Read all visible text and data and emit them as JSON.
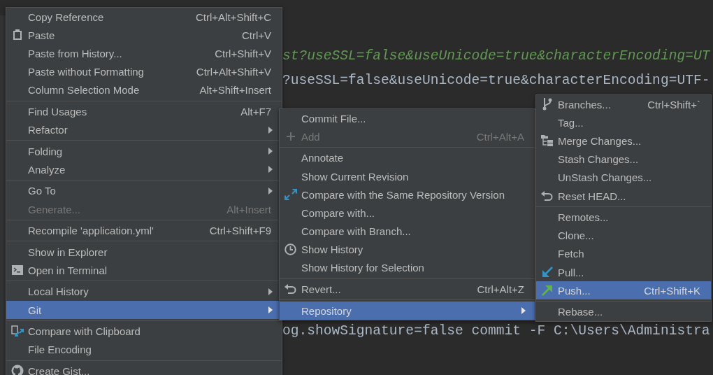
{
  "editor": {
    "lines": [
      {
        "kind": "string",
        "text": "st?useSSL=false&useUnicode=true&characterEncoding=UT"
      },
      {
        "kind": "plain",
        "text": "?useSSL=false&useUnicode=true&characterEncoding=UTF-"
      },
      {
        "kind": "plain",
        "text": "og.showSignature=false commit -F C:\\Users\\Administra"
      }
    ]
  },
  "menus": [
    {
      "items": [
        {
          "kind": "item",
          "label": "Copy Reference",
          "shortcut": "Ctrl+Alt+Shift+C",
          "submenu": false,
          "disabled": false,
          "selected": false
        },
        {
          "kind": "item",
          "label": "Paste",
          "shortcut": "Ctrl+V",
          "submenu": false,
          "disabled": false,
          "selected": false
        },
        {
          "kind": "item",
          "label": "Paste from History...",
          "shortcut": "Ctrl+Shift+V",
          "submenu": false,
          "disabled": false,
          "selected": false
        },
        {
          "kind": "item",
          "label": "Paste without Formatting",
          "shortcut": "Ctrl+Alt+Shift+V",
          "submenu": false,
          "disabled": false,
          "selected": false
        },
        {
          "kind": "item",
          "label": "Column Selection Mode",
          "shortcut": "Alt+Shift+Insert",
          "submenu": false,
          "disabled": false,
          "selected": false
        },
        {
          "kind": "separator"
        },
        {
          "kind": "item",
          "label": "Find Usages",
          "shortcut": "Alt+F7",
          "submenu": false,
          "disabled": false,
          "selected": false
        },
        {
          "kind": "item",
          "label": "Refactor",
          "submenu": true,
          "disabled": false,
          "selected": false
        },
        {
          "kind": "separator"
        },
        {
          "kind": "item",
          "label": "Folding",
          "submenu": true,
          "disabled": false,
          "selected": false
        },
        {
          "kind": "item",
          "label": "Analyze",
          "submenu": true,
          "disabled": false,
          "selected": false
        },
        {
          "kind": "separator"
        },
        {
          "kind": "item",
          "label": "Go To",
          "submenu": true,
          "disabled": false,
          "selected": false
        },
        {
          "kind": "item",
          "label": "Generate...",
          "shortcut": "Alt+Insert",
          "submenu": false,
          "disabled": true,
          "selected": false
        },
        {
          "kind": "separator"
        },
        {
          "kind": "item",
          "label": "Recompile 'application.yml'",
          "shortcut": "Ctrl+Shift+F9",
          "submenu": false,
          "disabled": false,
          "selected": false
        },
        {
          "kind": "separator"
        },
        {
          "kind": "item",
          "label": "Show in Explorer",
          "submenu": false,
          "disabled": false,
          "selected": false
        },
        {
          "kind": "item",
          "label": "Open in Terminal",
          "submenu": false,
          "disabled": false,
          "selected": false
        },
        {
          "kind": "separator"
        },
        {
          "kind": "item",
          "label": "Local History",
          "submenu": true,
          "disabled": false,
          "selected": false
        },
        {
          "kind": "item",
          "label": "Git",
          "submenu": true,
          "disabled": false,
          "selected": true
        },
        {
          "kind": "separator"
        },
        {
          "kind": "item",
          "label": "Compare with Clipboard",
          "submenu": false,
          "disabled": false,
          "selected": false
        },
        {
          "kind": "item",
          "label": "File Encoding",
          "submenu": false,
          "disabled": false,
          "selected": false
        },
        {
          "kind": "separator"
        },
        {
          "kind": "item",
          "label": "Create Gist...",
          "submenu": false,
          "disabled": false,
          "selected": false
        }
      ]
    },
    {
      "items": [
        {
          "kind": "item",
          "label": "Commit File...",
          "submenu": false,
          "disabled": false,
          "selected": false
        },
        {
          "kind": "item",
          "label": "Add",
          "shortcut": "Ctrl+Alt+A",
          "submenu": false,
          "disabled": true,
          "selected": false
        },
        {
          "kind": "separator"
        },
        {
          "kind": "item",
          "label": "Annotate",
          "submenu": false,
          "disabled": false,
          "selected": false
        },
        {
          "kind": "item",
          "label": "Show Current Revision",
          "submenu": false,
          "disabled": false,
          "selected": false
        },
        {
          "kind": "item",
          "label": "Compare with the Same Repository Version",
          "submenu": false,
          "disabled": false,
          "selected": false
        },
        {
          "kind": "item",
          "label": "Compare with...",
          "submenu": false,
          "disabled": false,
          "selected": false
        },
        {
          "kind": "item",
          "label": "Compare with Branch...",
          "submenu": false,
          "disabled": false,
          "selected": false
        },
        {
          "kind": "item",
          "label": "Show History",
          "submenu": false,
          "disabled": false,
          "selected": false
        },
        {
          "kind": "item",
          "label": "Show History for Selection",
          "submenu": false,
          "disabled": false,
          "selected": false
        },
        {
          "kind": "separator"
        },
        {
          "kind": "item",
          "label": "Revert...",
          "shortcut": "Ctrl+Alt+Z",
          "submenu": false,
          "disabled": false,
          "selected": false
        },
        {
          "kind": "separator"
        },
        {
          "kind": "item",
          "label": "Repository",
          "submenu": true,
          "disabled": false,
          "selected": true
        }
      ]
    },
    {
      "items": [
        {
          "kind": "item",
          "label": "Branches...",
          "shortcut": "Ctrl+Shift+`",
          "submenu": false,
          "disabled": false,
          "selected": false
        },
        {
          "kind": "item",
          "label": "Tag...",
          "submenu": false,
          "disabled": false,
          "selected": false
        },
        {
          "kind": "item",
          "label": "Merge Changes...",
          "submenu": false,
          "disabled": false,
          "selected": false
        },
        {
          "kind": "item",
          "label": "Stash Changes...",
          "submenu": false,
          "disabled": false,
          "selected": false
        },
        {
          "kind": "item",
          "label": "UnStash Changes...",
          "submenu": false,
          "disabled": false,
          "selected": false
        },
        {
          "kind": "item",
          "label": "Reset HEAD...",
          "submenu": false,
          "disabled": false,
          "selected": false
        },
        {
          "kind": "separator"
        },
        {
          "kind": "item",
          "label": "Remotes...",
          "submenu": false,
          "disabled": false,
          "selected": false
        },
        {
          "kind": "item",
          "label": "Clone...",
          "submenu": false,
          "disabled": false,
          "selected": false
        },
        {
          "kind": "item",
          "label": "Fetch",
          "submenu": false,
          "disabled": false,
          "selected": false
        },
        {
          "kind": "item",
          "label": "Pull...",
          "submenu": false,
          "disabled": false,
          "selected": false
        },
        {
          "kind": "item",
          "label": "Push...",
          "shortcut": "Ctrl+Shift+K",
          "submenu": false,
          "disabled": false,
          "selected": true
        },
        {
          "kind": "separator"
        },
        {
          "kind": "item",
          "label": "Rebase...",
          "submenu": false,
          "disabled": false,
          "selected": false
        }
      ]
    }
  ]
}
